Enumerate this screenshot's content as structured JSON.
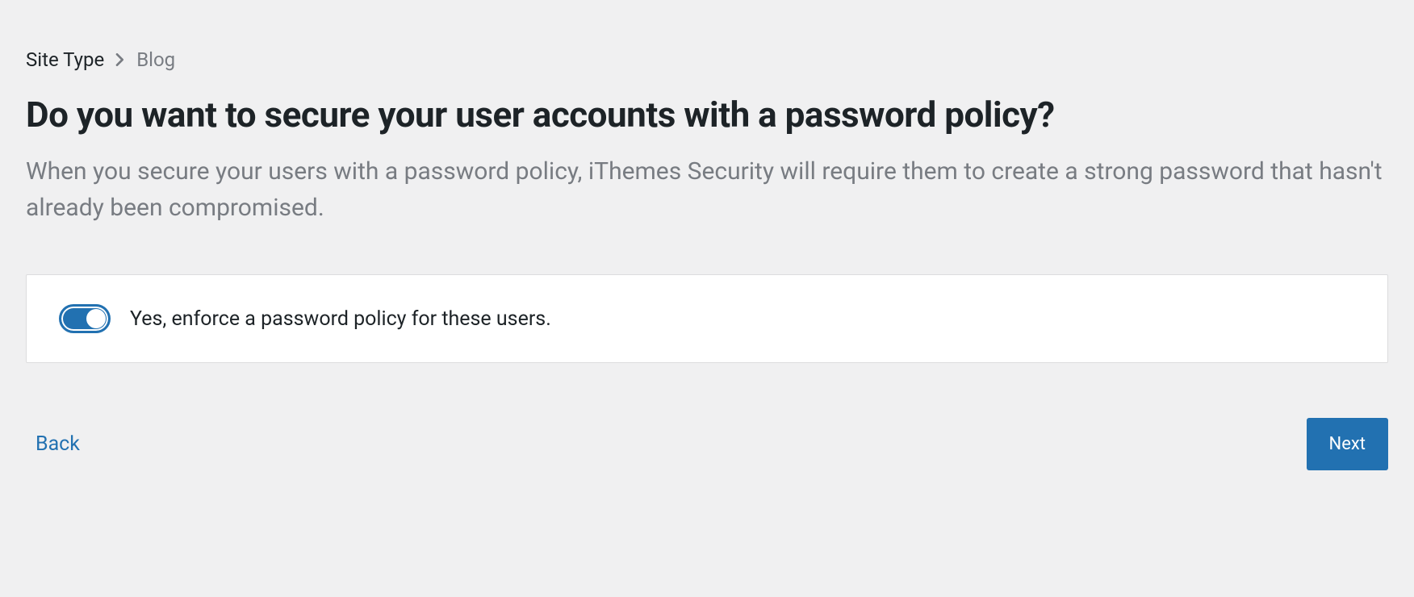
{
  "breadcrumb": {
    "parent": "Site Type",
    "current": "Blog"
  },
  "heading": "Do you want to secure your user accounts with a password policy?",
  "subtitle": "When you secure your users with a password policy, iThemes Security will require them to create a strong password that hasn't already been compromised.",
  "option": {
    "label": "Yes, enforce a password policy for these users.",
    "enabled": true
  },
  "actions": {
    "back_label": "Back",
    "next_label": "Next"
  }
}
